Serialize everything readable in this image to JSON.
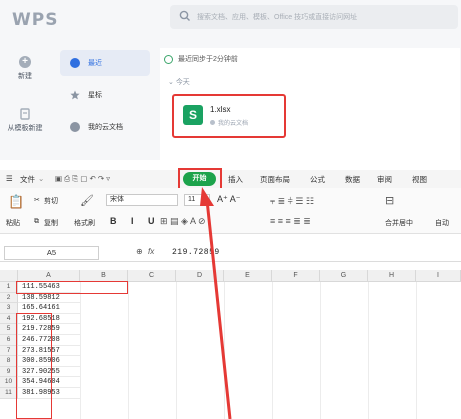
{
  "app": {
    "logo": "WPS",
    "search_placeholder": "搜索文档、应用、模板、Office 技巧或直接访问网址"
  },
  "rail": {
    "new_label": "新建",
    "new_from_label": "从模板新建"
  },
  "sidebar": {
    "items": [
      {
        "label": "最近",
        "icon": "clock-icon",
        "active": true
      },
      {
        "label": "星标",
        "icon": "star-icon",
        "active": false
      },
      {
        "label": "我的云文档",
        "icon": "cloud-icon",
        "active": false
      }
    ]
  },
  "recent": {
    "sync_text": "最近同步于2分钟前",
    "group_label": "今天",
    "file": {
      "name": "1.xlsx",
      "location": "我的云文档",
      "icon": "excel-icon"
    }
  },
  "menu": {
    "file": "文件",
    "start": "开始",
    "tabs": [
      "插入",
      "页面布局",
      "公式",
      "数据",
      "审阅",
      "视图"
    ]
  },
  "ribbon": {
    "paste": "粘贴",
    "cut": "剪切",
    "copy": "复制",
    "format_painter": "格式刷",
    "font_name": "宋体",
    "font_size": "11",
    "merge_center": "合并居中",
    "auto_wrap": "自动"
  },
  "formula": {
    "cell_ref": "A5",
    "fx": "fx",
    "value": "219.72859"
  },
  "columns": [
    "A",
    "B",
    "C",
    "D",
    "E",
    "F",
    "G",
    "H",
    "I"
  ],
  "rows": [
    {
      "num": "1",
      "a": "111.55463"
    },
    {
      "num": "2",
      "a": "138.59812"
    },
    {
      "num": "3",
      "a": "165.64161"
    },
    {
      "num": "4",
      "a": "192.68518"
    },
    {
      "num": "5",
      "a": "219.72859"
    },
    {
      "num": "6",
      "a": "246.77208"
    },
    {
      "num": "7",
      "a": "273.81557"
    },
    {
      "num": "8",
      "a": "300.85906"
    },
    {
      "num": "9",
      "a": "327.90255"
    },
    {
      "num": "10",
      "a": "354.94604"
    },
    {
      "num": "11",
      "a": "381.98953"
    }
  ],
  "colors": {
    "highlight": "#e53935",
    "start_green": "#1ca34b",
    "excel_green": "#1aa262",
    "accent_blue": "#2f6fe0"
  }
}
